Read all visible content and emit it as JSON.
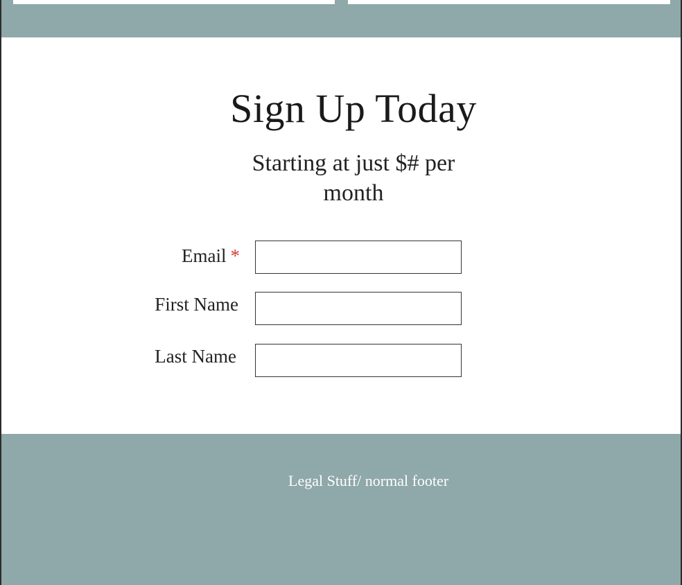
{
  "signup": {
    "title": "Sign Up Today",
    "subtitle": "Starting at just $# per month",
    "fields": [
      {
        "label": "Email",
        "required_mark": "*",
        "value": "",
        "placeholder": ""
      },
      {
        "label": "First Name",
        "value": "",
        "placeholder": ""
      },
      {
        "label": "Last Name",
        "value": "",
        "placeholder": ""
      }
    ]
  },
  "footer": {
    "text": "Legal Stuff/ normal footer"
  },
  "colors": {
    "band": "#8fa8aa",
    "required": "#d93a3a",
    "background": "#ffffff",
    "border": "#2b2b2b"
  }
}
